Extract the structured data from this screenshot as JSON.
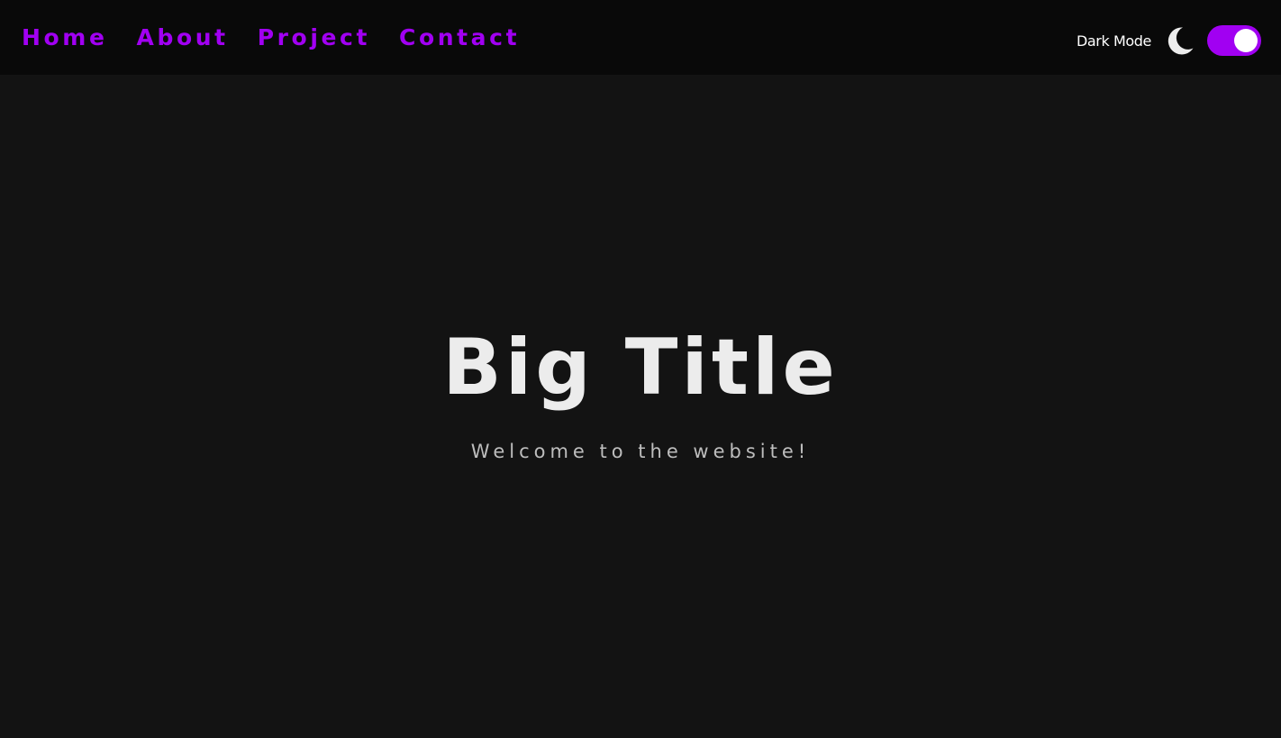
{
  "nav": {
    "links": [
      {
        "label": "Home"
      },
      {
        "label": "About"
      },
      {
        "label": "Project"
      },
      {
        "label": "Contact"
      }
    ],
    "mode_label": "Dark Mode",
    "mode_icon": "moon-icon",
    "toggle_on": true
  },
  "hero": {
    "title": "Big Title",
    "subtitle": "Welcome to the website!"
  },
  "colors": {
    "accent": "#a100f2",
    "background": "#131313",
    "navbar": "#090909",
    "title": "#ececec",
    "subtitle": "#bdbdbd"
  }
}
